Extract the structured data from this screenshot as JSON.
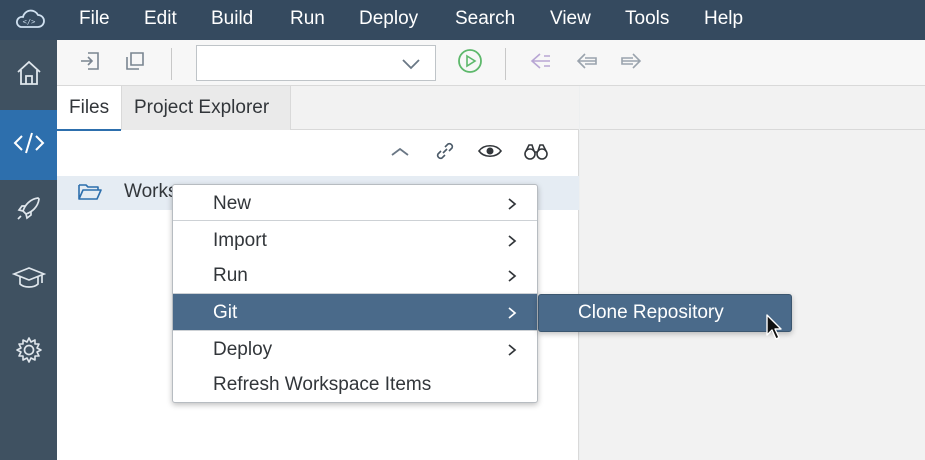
{
  "menubar": {
    "items": [
      "File",
      "Edit",
      "Build",
      "Run",
      "Deploy",
      "Search",
      "View",
      "Tools",
      "Help"
    ]
  },
  "rail": {
    "items": [
      "home",
      "code",
      "rocket",
      "learning",
      "settings"
    ],
    "active": "code"
  },
  "toolbar": {
    "run_configuration_value": ""
  },
  "tabs": {
    "files": "Files",
    "project_explorer": "Project Explorer"
  },
  "tree": {
    "root_label": "Works"
  },
  "context_menu": {
    "items": [
      "New",
      "Import",
      "Run",
      "Git",
      "Deploy",
      "Refresh Workspace Items"
    ],
    "highlighted": "Git"
  },
  "submenu": {
    "items": [
      "Clone Repository"
    ]
  },
  "colors": {
    "menubar_bg": "#354a5f",
    "rail_bg": "#3f5161",
    "rail_active": "#2d6fad",
    "highlight": "#4a6a8a",
    "run_green": "#5db86b"
  }
}
